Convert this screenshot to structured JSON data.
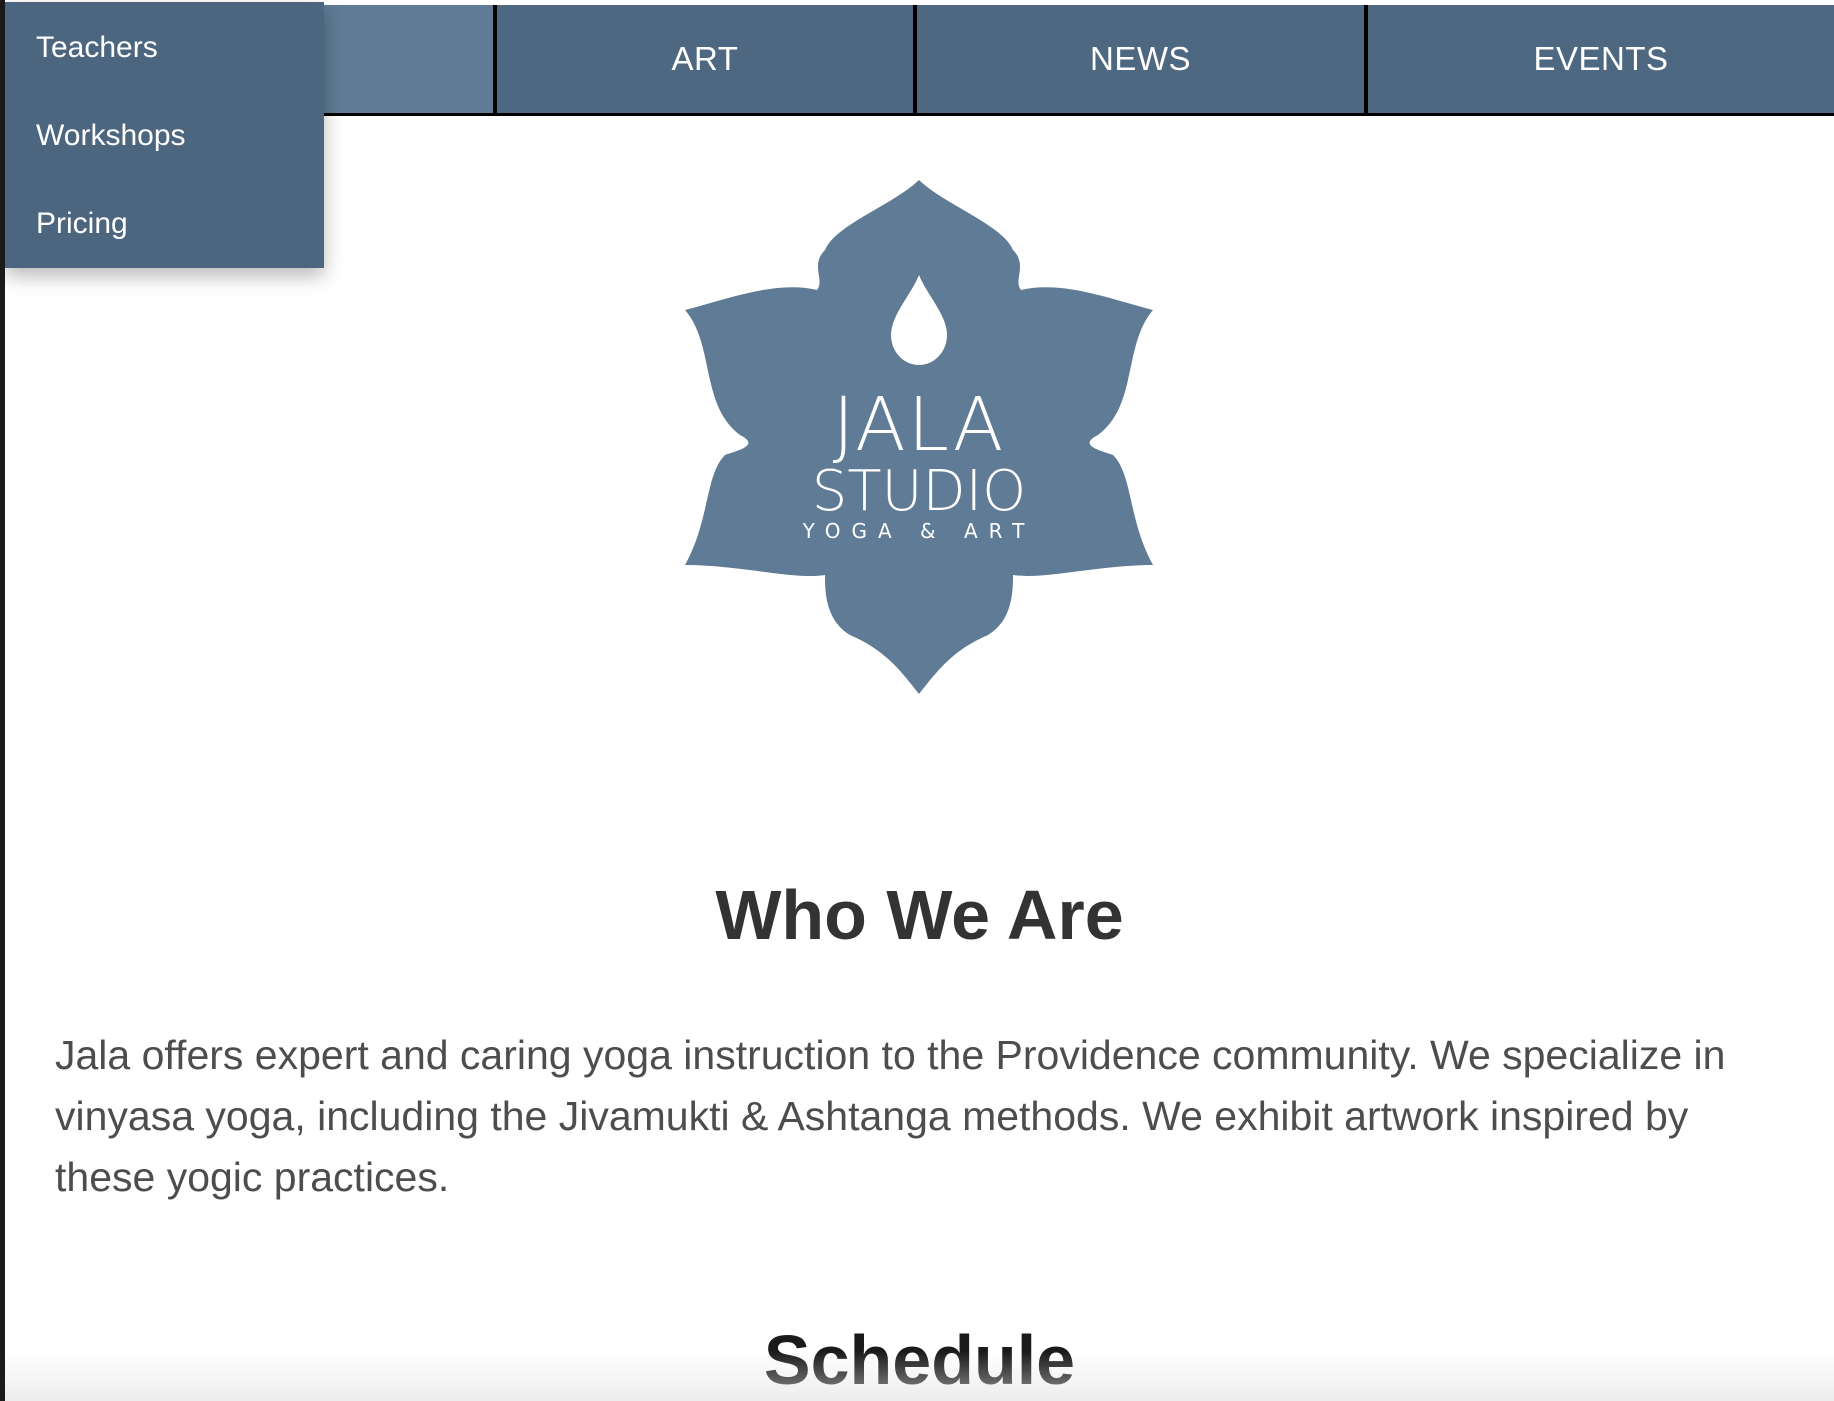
{
  "nav": {
    "items": [
      {
        "label": ""
      },
      {
        "label": "ART"
      },
      {
        "label": "NEWS"
      },
      {
        "label": "EVENTS"
      }
    ],
    "dropdown": [
      "Teachers",
      "Workshops",
      "Pricing"
    ]
  },
  "logo": {
    "line1": "JALA",
    "line2": "STUDIO",
    "line3": "YOGA & ART",
    "color": "#5f7b95"
  },
  "about": {
    "title": "Who We Are",
    "body": "Jala offers expert and caring yoga instruction to the Providence community. We specialize in vinyasa yoga, including the Jivamukti & Ashtanga methods. We exhibit artwork inspired by these yogic practices."
  },
  "schedule": {
    "title": "Schedule"
  },
  "colors": {
    "nav_bg": "#4f6881",
    "nav_active": "#5f7b95",
    "dropdown_bg": "#4c6680"
  }
}
